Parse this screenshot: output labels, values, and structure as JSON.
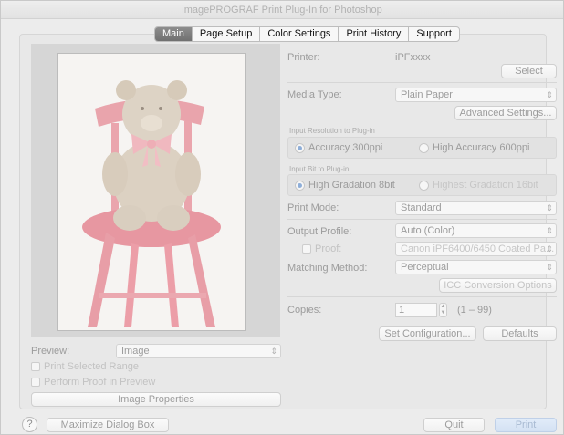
{
  "window": {
    "title": "imagePROGRAF Print Plug-In for Photoshop"
  },
  "tabs": [
    {
      "label": "Main",
      "active": true
    },
    {
      "label": "Page Setup",
      "active": false
    },
    {
      "label": "Color Settings",
      "active": false
    },
    {
      "label": "Print History",
      "active": false
    },
    {
      "label": "Support",
      "active": false
    }
  ],
  "printer": {
    "label": "Printer:",
    "value": "iPFxxxx",
    "select_label": "Select"
  },
  "media_type": {
    "label": "Media Type:",
    "value": "Plain Paper",
    "advanced_label": "Advanced Settings..."
  },
  "input_resolution": {
    "label": "Input Resolution to Plug-in",
    "options": [
      "Accuracy 300ppi",
      "High Accuracy 600ppi"
    ],
    "selected": "Accuracy 300ppi"
  },
  "input_bit": {
    "label": "Input Bit to Plug-in",
    "options": [
      "High Gradation 8bit",
      "Highest Gradation 16bit"
    ],
    "selected": "High Gradation 8bit"
  },
  "print_mode": {
    "label": "Print Mode:",
    "value": "Standard"
  },
  "output_profile": {
    "label": "Output Profile:",
    "value": "Auto (Color)"
  },
  "proof": {
    "label": "Proof:",
    "value": "Canon iPF6400/6450 Coated Pa..."
  },
  "matching_method": {
    "label": "Matching Method:",
    "value": "Perceptual"
  },
  "icc_conversion_label": "ICC Conversion Options",
  "copies": {
    "label": "Copies:",
    "value": "1",
    "range": "(1 – 99)"
  },
  "set_configuration_label": "Set Configuration...",
  "defaults_label": "Defaults",
  "preview": {
    "label": "Preview:",
    "value": "Image"
  },
  "print_selected_range_label": "Print Selected Range",
  "perform_proof_label": "Perform Proof in Preview",
  "image_properties_label": "Image Properties",
  "help_label": "?",
  "maximize_label": "Maximize Dialog Box",
  "quit_label": "Quit",
  "print_label": "Print",
  "colors": {
    "accent": "#8eaed8",
    "print_button": "#d3e1f3"
  }
}
